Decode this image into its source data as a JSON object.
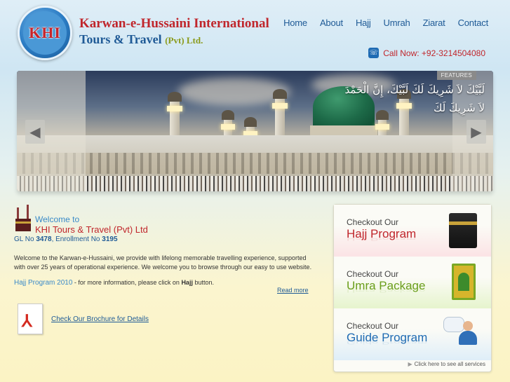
{
  "header": {
    "logo_text": "KHI",
    "brand_line1": "Karwan-e-Hussaini International",
    "brand_line2": "Tours & Travel",
    "brand_pvt": "(Pvt) Ltd.",
    "call_label": "Call Now: +92-3214504080"
  },
  "nav": [
    "Home",
    "About",
    "Hajj",
    "Umrah",
    "Ziarat",
    "Contact"
  ],
  "banner": {
    "features_tag": "FEATURES",
    "arabic_line1": "لَبَّيْكَ لاَ شَرِيكَ لَكَ لَبَّيْكَ، إِنَّ الْحَمْدَ",
    "arabic_line2": "لاَ شَرِيكَ لَكَ",
    "prev_icon": "left-arrow-icon",
    "next_icon": "right-arrow-icon"
  },
  "welcome": {
    "small": "Welcome to",
    "title": "KHI Tours & Travel (Pvt) Ltd",
    "gl_prefix": "GL No ",
    "gl_no": "3478",
    "enroll_prefix": ", Enrollment No ",
    "enroll_no": "3195",
    "description": "Welcome to the Karwan-e-Hussaini, we provide with lifelong memorable travelling experience, supported with over 25 years of operational experience. We welcome you to browse through our easy to use website.",
    "hajj_program": "Hajj Program 2010",
    "hajj_text": " - for more information, please click on ",
    "hajj_bold": "Hajj",
    "hajj_text2": " button.",
    "read_more": "Read more",
    "brochure": "Check Our Brochure for Details"
  },
  "services": {
    "items": [
      {
        "small": "Checkout Our",
        "big": "Hajj Program"
      },
      {
        "small": "Checkout Our",
        "big": "Umra Package"
      },
      {
        "small": "Checkout Our",
        "big": "Guide Program"
      }
    ],
    "see_all": "Click here to see all services"
  }
}
